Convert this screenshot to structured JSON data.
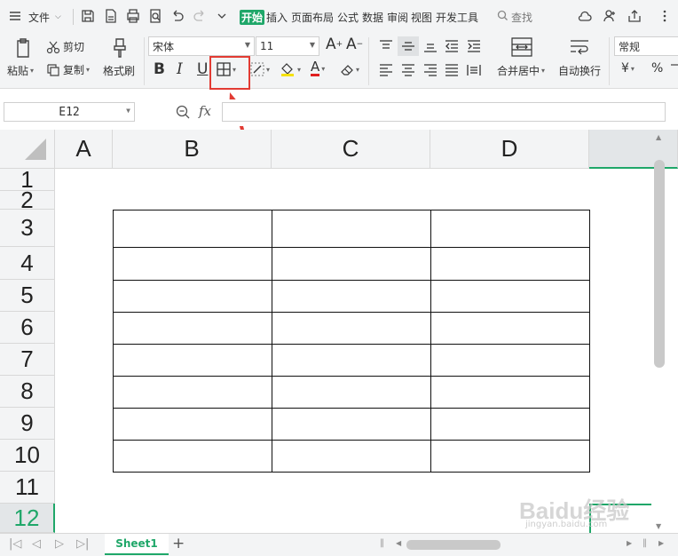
{
  "menubar": {
    "file_label": "文件",
    "tabs": [
      "开始",
      "插入",
      "页面布局",
      "公式",
      "数据",
      "审阅",
      "视图",
      "开发工具"
    ],
    "search_label": "查找"
  },
  "ribbon": {
    "paste_label": "粘贴",
    "cut_label": "剪切",
    "copy_label": "复制",
    "format_painter_label": "格式刷",
    "font_name": "宋体",
    "font_size": "11",
    "merge_center_label": "合并居中",
    "wrap_text_label": "自动换行",
    "number_format": "常规",
    "currency_symbol": "¥",
    "percent_symbol": "%",
    "bold_label": "B",
    "italic_label": "I",
    "underline_label": "U",
    "font_color_label": "A",
    "grow_font_label": "A",
    "shrink_font_label": "A",
    "accent_color": "#1fa769",
    "highlight_color": "#e23b33"
  },
  "formula_bar": {
    "cell_ref": "E12",
    "fx_label": "fx",
    "formula_value": ""
  },
  "grid": {
    "columns": [
      "A",
      "B",
      "C",
      "D"
    ],
    "rows": [
      "1",
      "2",
      "3",
      "4",
      "5",
      "6",
      "7",
      "8",
      "9",
      "10",
      "11",
      "12"
    ],
    "selected_row": "12"
  },
  "sheet_tabs": {
    "active": "Sheet1",
    "add_label": "+"
  },
  "watermark": {
    "text": "Baidu经验",
    "sub": "jingyan.baidu.com"
  }
}
